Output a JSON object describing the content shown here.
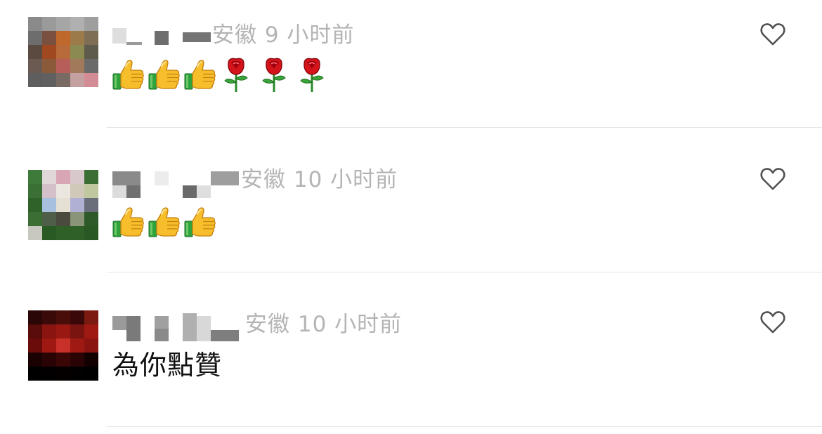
{
  "comments": [
    {
      "location": "安徽",
      "time": "9 小时前",
      "reactions": [
        "thumbs-up",
        "thumbs-up",
        "thumbs-up",
        "rose",
        "rose",
        "rose"
      ],
      "text": "",
      "like_icon": "heart-outline-icon",
      "avatar_palette": [
        [
          "#8a8a8a",
          "#9a9a9a",
          "#a6a6a6",
          "#b0b0b0",
          "#9e9e9e"
        ],
        [
          "#6d6d6d",
          "#7a5040",
          "#c0682c",
          "#9c7a4a",
          "#7e6e56"
        ],
        [
          "#5a4a40",
          "#a04820",
          "#b86a3a",
          "#8a8a52",
          "#5e5a4c"
        ],
        [
          "#6a5a52",
          "#8a5a3a",
          "#b85e5a",
          "#a07a5a",
          "#6a6a6a"
        ],
        [
          "#5e5e5e",
          "#606060",
          "#7a6a64",
          "#c4a0a0",
          "#d48c94"
        ]
      ]
    },
    {
      "location": "安徽",
      "time": "10 小时前",
      "reactions": [
        "thumbs-up",
        "thumbs-up",
        "thumbs-up"
      ],
      "text": "",
      "like_icon": "heart-outline-icon",
      "avatar_palette": [
        [
          "#3e7a3a",
          "#e0d8d8",
          "#d8a6b4",
          "#d8c8cc",
          "#3a6e32"
        ],
        [
          "#3a7034",
          "#d4c0c8",
          "#ece6e0",
          "#d0c8b8",
          "#c0c8a0"
        ],
        [
          "#2e6228",
          "#a8c0e0",
          "#e6e0d4",
          "#b0b0d4",
          "#6a6e7a"
        ],
        [
          "#3a6e32",
          "#4e5e48",
          "#4a4a3e",
          "#8a9478",
          "#2e5a2a"
        ],
        [
          "#c8c8c0",
          "#2a5a24",
          "#2e6028",
          "#2e6028",
          "#2a5824"
        ]
      ]
    },
    {
      "location": "安徽",
      "time": "10 小时前",
      "reactions": [],
      "text": "為你點贊",
      "like_icon": "heart-outline-icon",
      "avatar_palette": [
        [
          "#2a0606",
          "#3a0a08",
          "#4a0e0a",
          "#3a0808",
          "#7a1a10"
        ],
        [
          "#5a0c0a",
          "#8a1410",
          "#9a1812",
          "#7a1410",
          "#a01a14"
        ],
        [
          "#6a0c0a",
          "#a01812",
          "#c8302a",
          "#a01a14",
          "#8a1410"
        ],
        [
          "#1a0202",
          "#2a0404",
          "#3a0606",
          "#2a0404",
          "#120000"
        ],
        [
          "#000000",
          "#020000",
          "#040000",
          "#020000",
          "#000000"
        ]
      ]
    }
  ],
  "colors": {
    "meta_text": "#b4b4b4",
    "comment_text": "#111111",
    "divider": "#e6e6e6",
    "heart_stroke": "#505050"
  }
}
